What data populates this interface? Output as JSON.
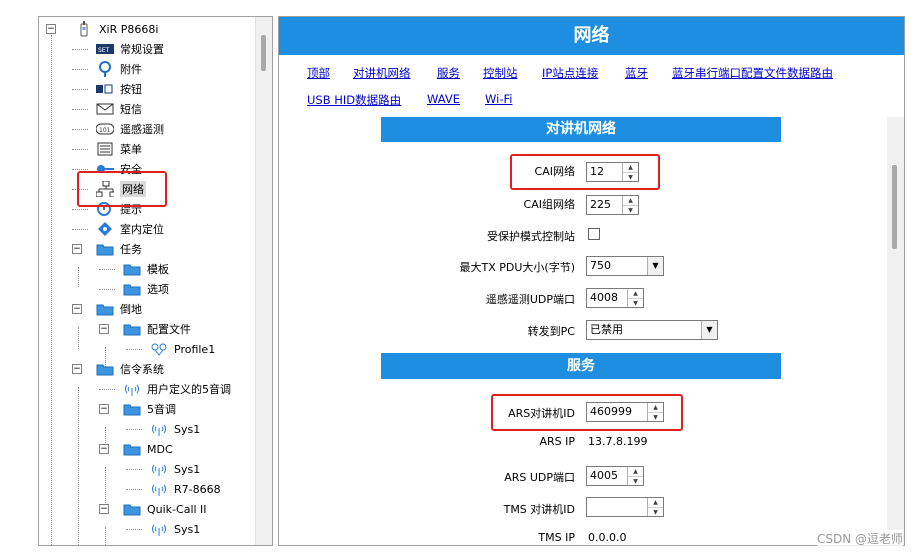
{
  "tree": {
    "root": "XiR P8668i",
    "items": [
      {
        "label": "常规设置",
        "icon": "settings-card-icon"
      },
      {
        "label": "附件",
        "icon": "accessory-icon"
      },
      {
        "label": "按钮",
        "icon": "button-icon"
      },
      {
        "label": "短信",
        "icon": "envelope-icon"
      },
      {
        "label": "遥感遥测",
        "icon": "telemetry-icon"
      },
      {
        "label": "菜单",
        "icon": "menu-icon"
      },
      {
        "label": "安全",
        "icon": "key-icon"
      },
      {
        "label": "网络",
        "icon": "network-icon"
      },
      {
        "label": "提示",
        "icon": "alert-icon"
      },
      {
        "label": "室内定位",
        "icon": "location-icon"
      },
      {
        "label": "任务",
        "icon": "folder-icon"
      },
      {
        "label": "模板",
        "icon": "folder-icon"
      },
      {
        "label": "选项",
        "icon": "folder-icon"
      },
      {
        "label": "倒地",
        "icon": "folder-icon"
      },
      {
        "label": "配置文件",
        "icon": "folder-icon"
      },
      {
        "label": "Profile1",
        "icon": "profile-icon"
      },
      {
        "label": "信令系统",
        "icon": "folder-icon"
      },
      {
        "label": "用户定义的5音调",
        "icon": "signal-icon"
      },
      {
        "label": "5音调",
        "icon": "folder-icon"
      },
      {
        "label": "Sys1",
        "icon": "signal-icon"
      },
      {
        "label": "MDC",
        "icon": "folder-icon"
      },
      {
        "label": "Sys1",
        "icon": "signal-icon"
      },
      {
        "label": "R7-8668",
        "icon": "signal-icon"
      },
      {
        "label": "Quik-Call II",
        "icon": "folder-icon"
      },
      {
        "label": "Sys1",
        "icon": "signal-icon"
      }
    ]
  },
  "page": {
    "title": "网络",
    "links": [
      "顶部",
      "对讲机网络",
      "服务",
      "控制站",
      "IP站点连接",
      "蓝牙",
      "蓝牙串行端口配置文件数据路由",
      "USB HID数据路由",
      "WAVE",
      "Wi-Fi"
    ]
  },
  "sections": {
    "radio_network": "对讲机网络",
    "services": "服务"
  },
  "fields": {
    "cai_network": {
      "label": "CAI网络",
      "value": "12"
    },
    "cai_group_network": {
      "label": "CAI组网络",
      "value": "225"
    },
    "protected_control_station": {
      "label": "受保护模式控制站"
    },
    "max_tx_pdu": {
      "label": "最大TX PDU大小(字节)",
      "value": "750"
    },
    "telemetry_udp_port": {
      "label": "遥感遥测UDP端口",
      "value": "4008"
    },
    "forward_to_pc": {
      "label": "转发到PC",
      "value": "已禁用"
    },
    "ars_radio_id": {
      "label": "ARS对讲机ID",
      "value": "460999"
    },
    "ars_ip": {
      "label": "ARS IP",
      "value": "13.7.8.199"
    },
    "ars_udp_port": {
      "label": "ARS UDP端口",
      "value": "4005"
    },
    "tms_radio_id": {
      "label": "TMS 对讲机ID",
      "value": ""
    },
    "tms_ip": {
      "label": "TMS IP",
      "value": "0.0.0.0"
    }
  },
  "watermark": "CSDN @逗老师",
  "colors": {
    "header": "#1e8fe0",
    "highlight": "#e02020",
    "link": "#0000cc"
  }
}
